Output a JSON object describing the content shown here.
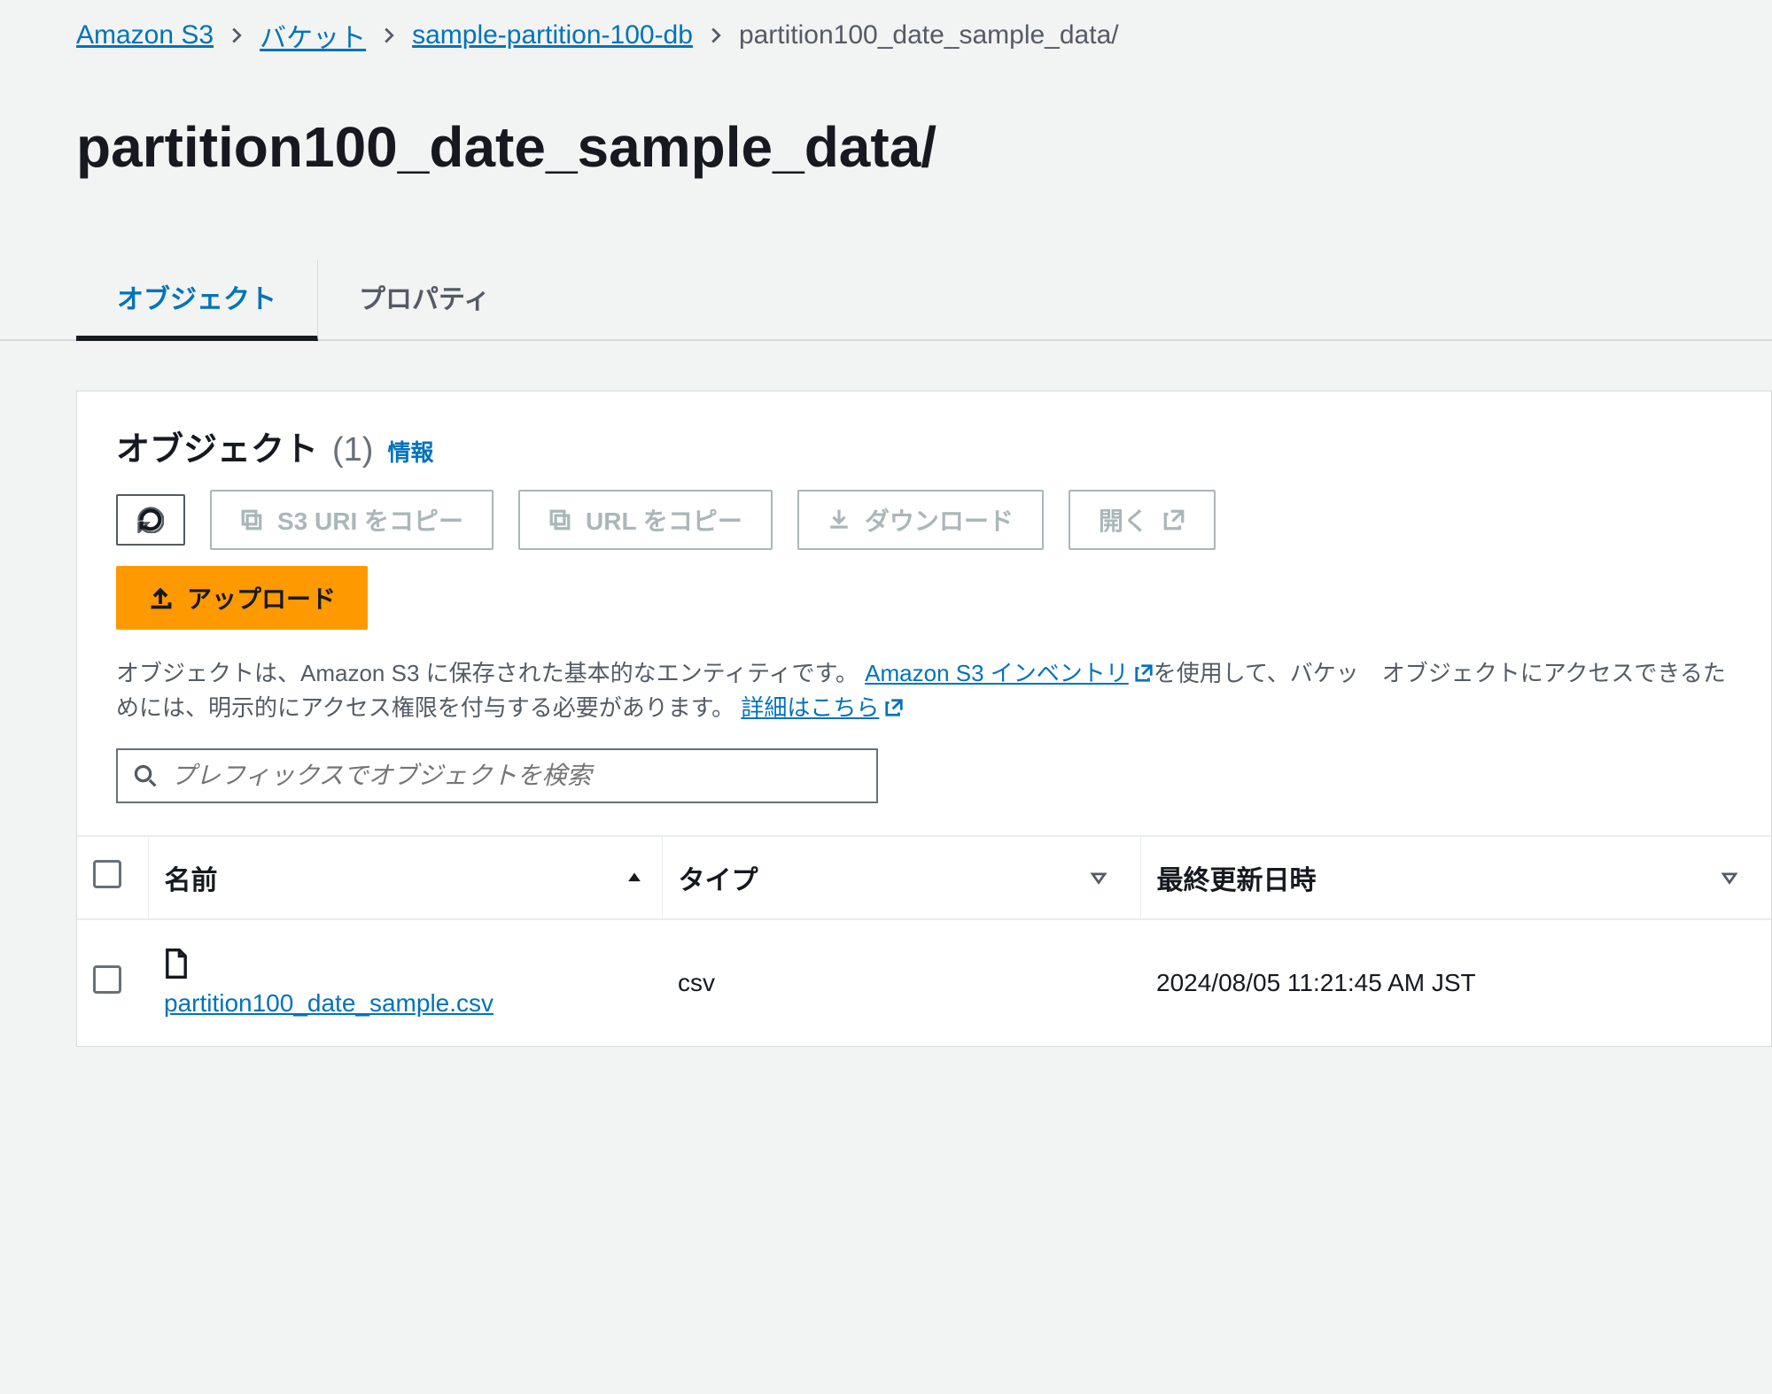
{
  "breadcrumb": {
    "items": [
      {
        "label": "Amazon S3",
        "link": true
      },
      {
        "label": "バケット",
        "link": true
      },
      {
        "label": "sample-partition-100-db",
        "link": true
      },
      {
        "label": "partition100_date_sample_data/",
        "link": false
      }
    ]
  },
  "page": {
    "title": "partition100_date_sample_data/"
  },
  "tabs": [
    {
      "id": "objects",
      "label": "オブジェクト",
      "active": true
    },
    {
      "id": "properties",
      "label": "プロパティ",
      "active": false
    }
  ],
  "objectsPanel": {
    "heading": "オブジェクト",
    "count": "(1)",
    "infoLabel": "情報",
    "actions": {
      "refresh": "",
      "copyS3Uri": "S3 URI をコピー",
      "copyUrl": "URL をコピー",
      "download": "ダウンロード",
      "open": "開く",
      "upload": "アップロード"
    },
    "description": {
      "pre": "オブジェクトは、Amazon S3 に保存された基本的なエンティティです。",
      "inventoryLink": "Amazon S3 インベントリ",
      "mid": "を使用して、バケッ　オブジェクトにアクセスできるためには、明示的にアクセス権限を付与する必要があります。",
      "learnMore": "詳細はこちら"
    },
    "search": {
      "placeholder": "プレフィックスでオブジェクトを検索"
    },
    "columns": {
      "name": "名前",
      "type": "タイプ",
      "modified": "最終更新日時"
    },
    "rows": [
      {
        "name": "partition100_date_sample.csv",
        "type": "csv",
        "modified": "2024/08/05 11:21:45 AM JST"
      }
    ]
  }
}
